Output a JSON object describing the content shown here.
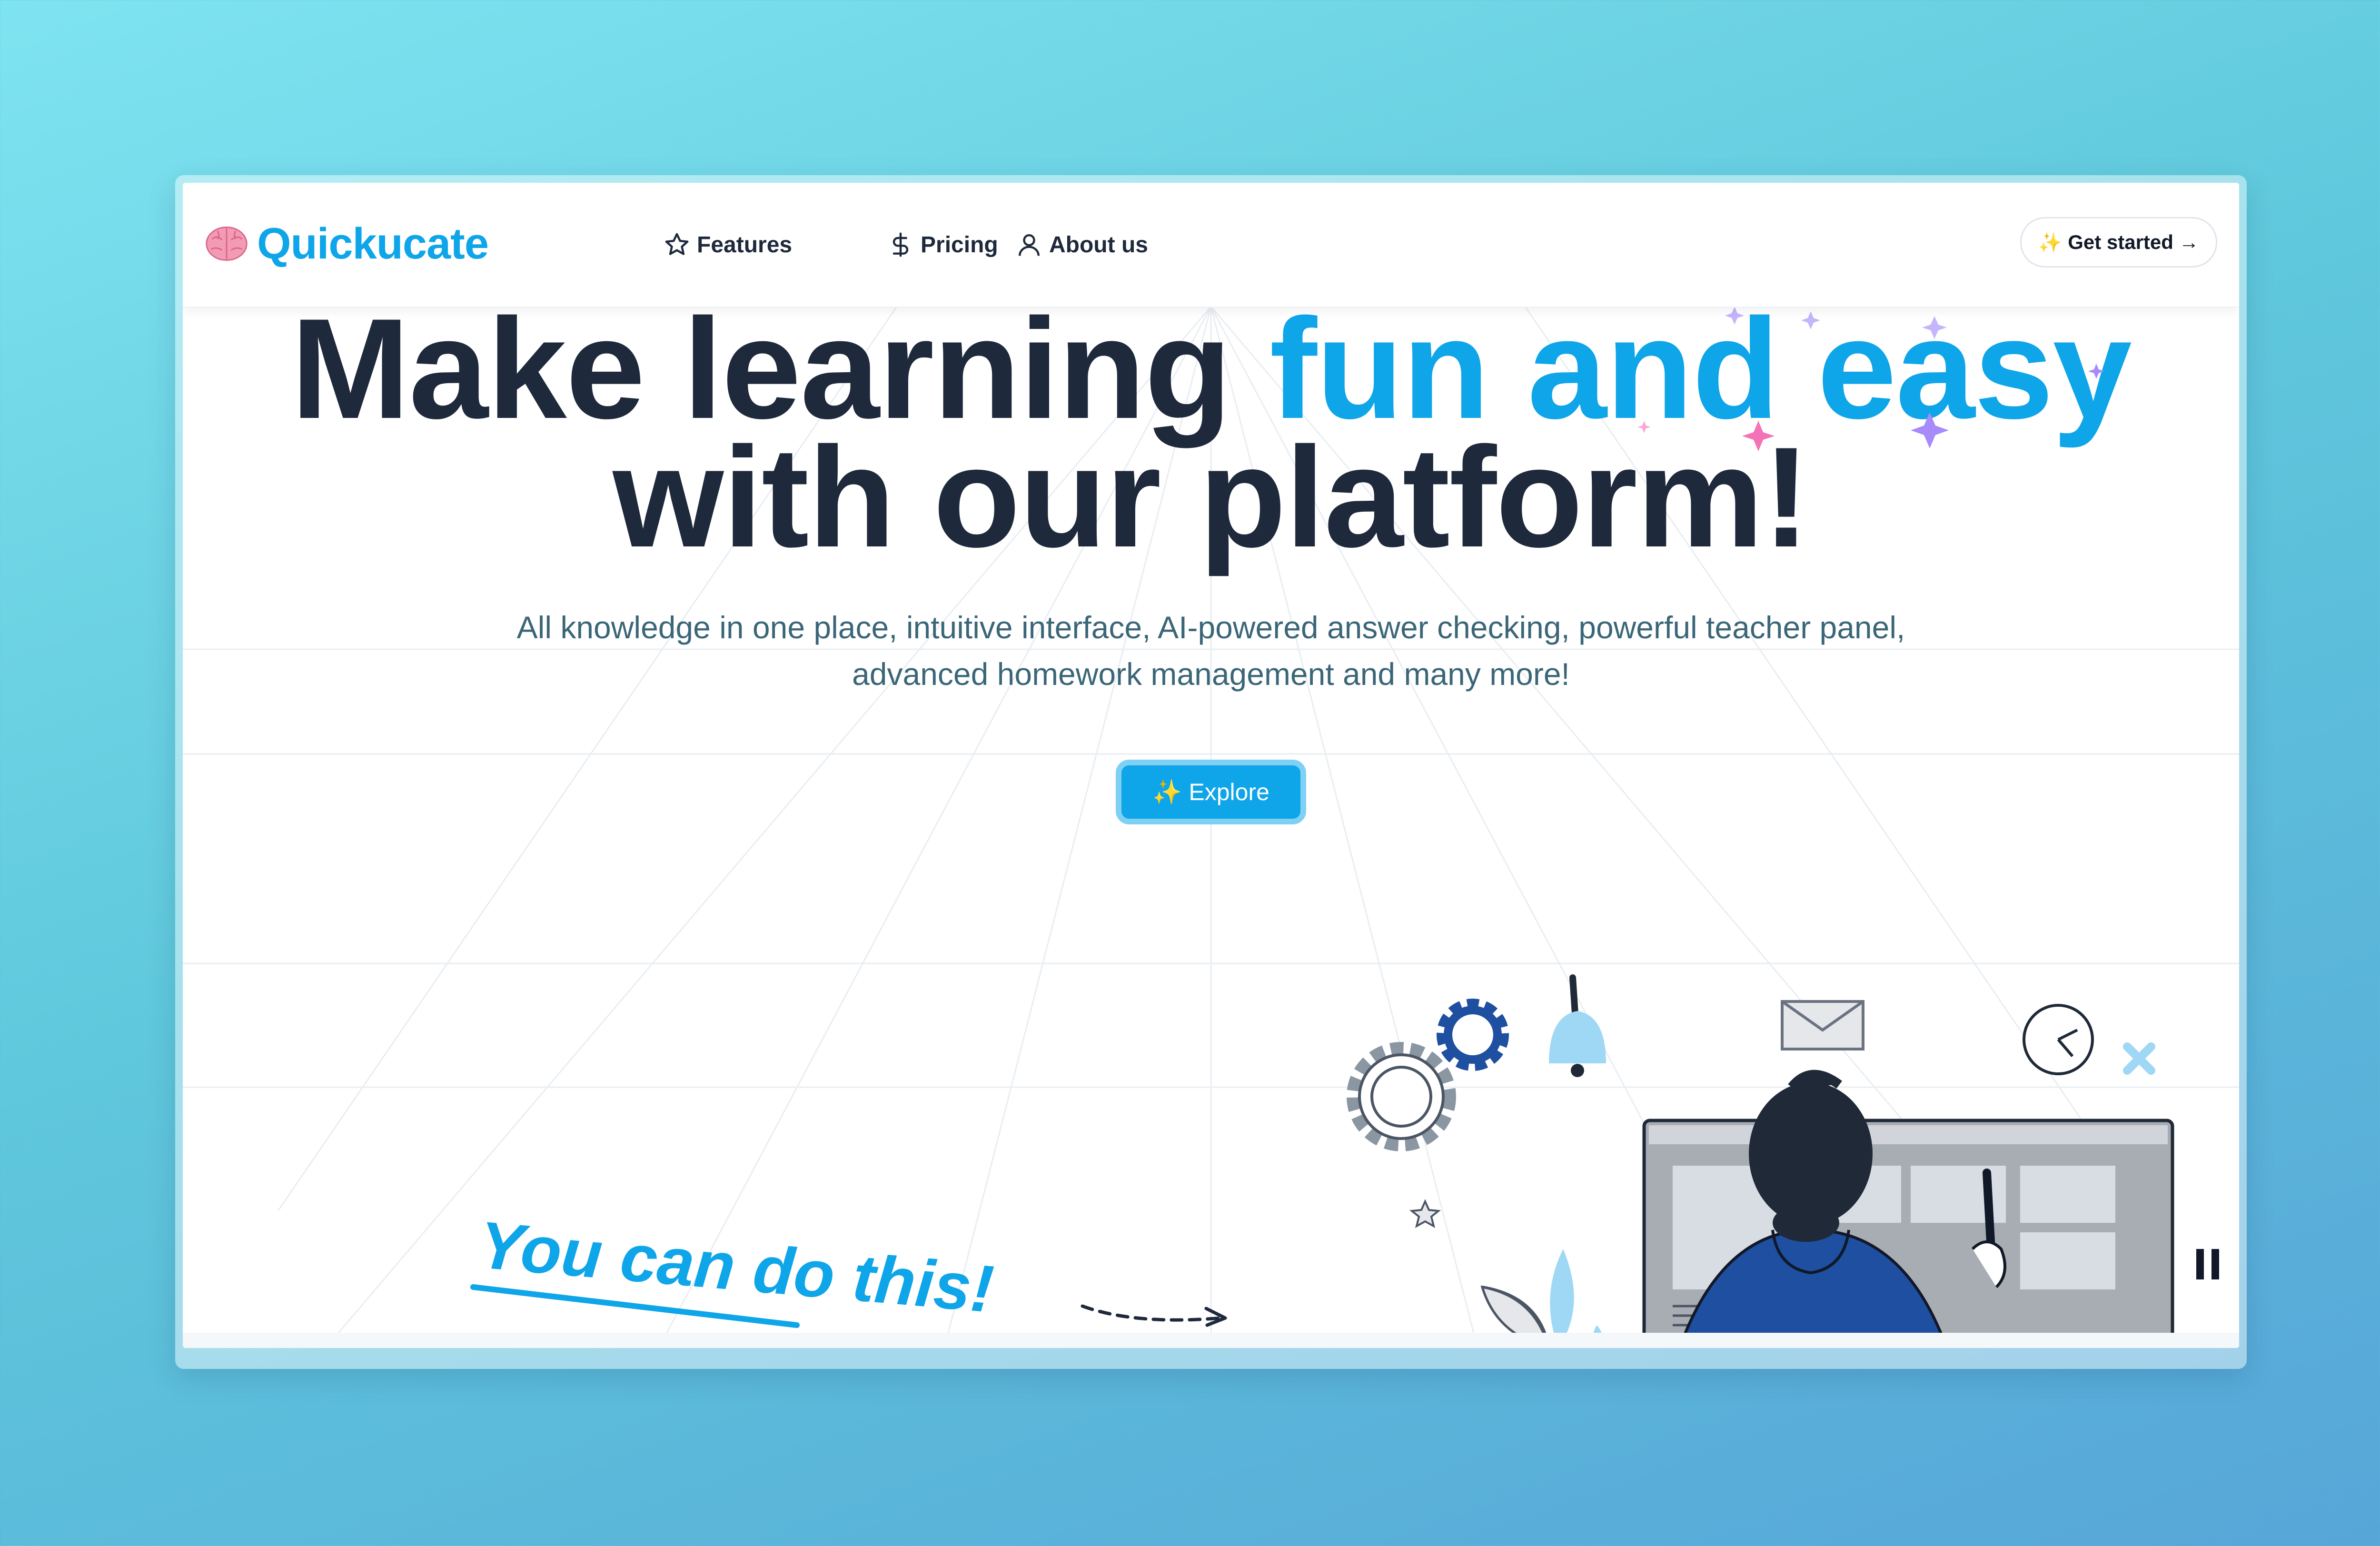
{
  "brand": {
    "logo_icon": "brain-icon",
    "name": "Quickucate"
  },
  "nav": {
    "links": [
      {
        "label": "Features",
        "icon": "star-icon"
      },
      {
        "label": "Pricing",
        "icon": "dollar-icon"
      },
      {
        "label": "About us",
        "icon": "user-icon"
      }
    ],
    "cta": {
      "spark": "✨",
      "label": "Get started →"
    }
  },
  "hero": {
    "line1_plain": "Make learning ",
    "line1_accent": "fun and easy",
    "line2": "with our platform!",
    "subtitle_line1": "All knowledge in one place, intuitive interface, AI-powered answer checking, powerful teacher panel,",
    "subtitle_line2": "advanced homework management and many more!",
    "explore_spark": "✨",
    "explore_label": "Explore"
  },
  "doodle": {
    "text": "You can do this!"
  },
  "colors": {
    "accent": "#0ea5e9",
    "heading": "#1e293b",
    "subtitle": "#3a6678"
  }
}
